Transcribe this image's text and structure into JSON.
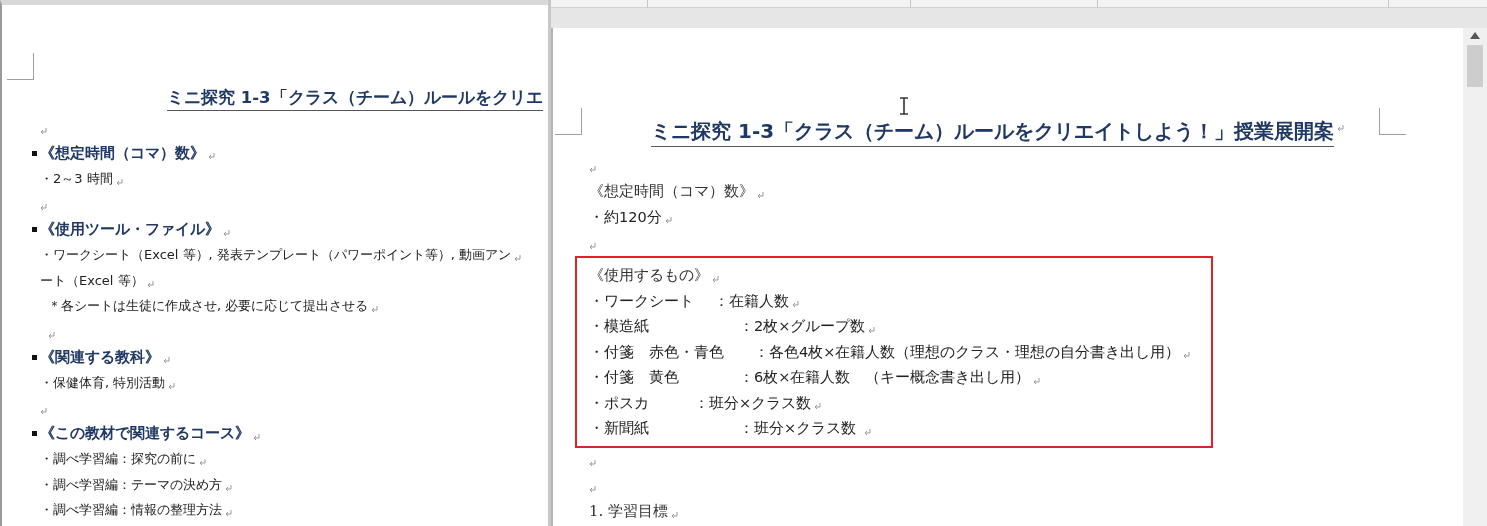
{
  "left_document": {
    "title": "ミニ探究 1-3「クラス（チーム）ルールをクリエ",
    "paragraphs": [
      {
        "kind": "blank"
      },
      {
        "kind": "heading",
        "text": "《想定時間（コマ）数》"
      },
      {
        "kind": "text",
        "text": "・2～3 時間"
      },
      {
        "kind": "blank"
      },
      {
        "kind": "heading",
        "text": "《使用ツール・ファイル》"
      },
      {
        "kind": "text",
        "text": "・ワークシート（Excel 等）, 発表テンプレート（パワーポイント等）, 動画アン"
      },
      {
        "kind": "text",
        "text": "ート（Excel 等）"
      },
      {
        "kind": "note",
        "text": "＊各シートは生徒に作成させ, 必要に応じて提出させる"
      },
      {
        "kind": "note_blank"
      },
      {
        "kind": "heading",
        "text": "《関連する教科》"
      },
      {
        "kind": "text",
        "text": "・保健体育, 特別活動"
      },
      {
        "kind": "blank"
      },
      {
        "kind": "heading",
        "text": "《この教材で関連するコース》"
      },
      {
        "kind": "text",
        "text": "・調べ学習編：探究の前に"
      },
      {
        "kind": "text",
        "text": "・調べ学習編：テーマの決め方"
      },
      {
        "kind": "text",
        "text": "・調べ学習編：情報の整理方法"
      }
    ]
  },
  "right_document": {
    "title": "ミニ探究 1-3「クラス（チーム）ルールをクリエイトしよう！」授業展開案",
    "before": [
      {
        "kind": "blank"
      },
      {
        "kind": "heading",
        "text": "《想定時間（コマ）数》"
      },
      {
        "kind": "text",
        "text": "・約120分"
      },
      {
        "kind": "blank"
      }
    ],
    "boxed": [
      {
        "kind": "heading",
        "text": "《使用するもの》"
      },
      {
        "kind": "text",
        "text": "・ワークシート　 ：在籍人数"
      },
      {
        "kind": "text",
        "text": "・模造紙　　　　　　：2枚×グループ数"
      },
      {
        "kind": "text",
        "text": "・付箋　赤色・青色　　：各色4枚×在籍人数（理想のクラス・理想の自分書き出し用）"
      },
      {
        "kind": "text",
        "text": "・付箋　黄色　　　　：6枚×在籍人数　（キー概念書き出し用）"
      },
      {
        "kind": "text",
        "text": "・ポスカ　　　：班分×クラス数"
      },
      {
        "kind": "text",
        "text": "・新聞紙　　　　　　：班分×クラス数 "
      }
    ],
    "after": [
      {
        "kind": "blank"
      },
      {
        "kind": "blank"
      },
      {
        "kind": "heading",
        "text": "1. 学習目標"
      }
    ]
  }
}
